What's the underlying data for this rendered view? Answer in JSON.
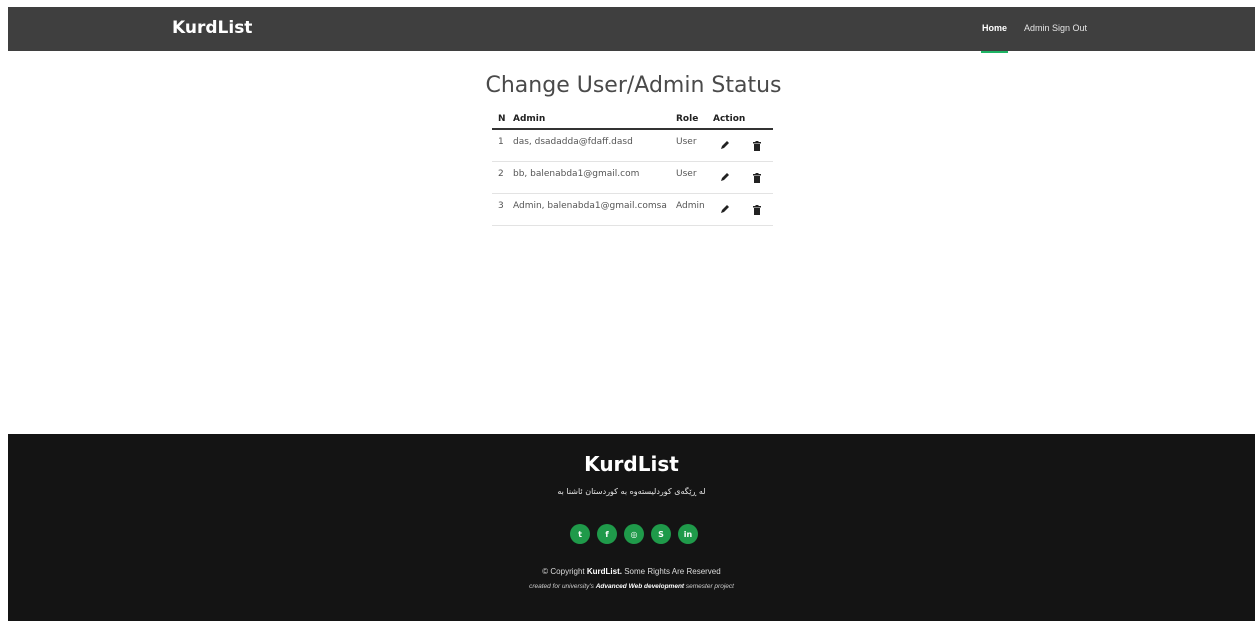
{
  "header": {
    "brand": "KurdList",
    "nav": [
      {
        "label": "Home"
      },
      {
        "label": "Admin Sign Out"
      }
    ]
  },
  "main": {
    "title": "Change User/Admin Status",
    "columns": [
      "N",
      "Admin",
      "Role",
      "Action"
    ],
    "rows": [
      {
        "n": "1",
        "admin": "das,  dsadadda@fdaff.dasd",
        "role": "User"
      },
      {
        "n": "2",
        "admin": "bb,  balenabda1@gmail.com",
        "role": "User"
      },
      {
        "n": "3",
        "admin": "Admin,  balenabda1@gmail.comsa",
        "role": "Admin"
      }
    ]
  },
  "footer": {
    "brand": "KurdList",
    "tagline": "له ڕێگەی کوردلیستەوە بە کوردستان ئاشنا بە",
    "socials": [
      {
        "icon": "twitter-icon",
        "glyph": "t"
      },
      {
        "icon": "facebook-icon",
        "glyph": "f"
      },
      {
        "icon": "instagram-icon",
        "glyph": "◎"
      },
      {
        "icon": "skype-icon",
        "glyph": "S"
      },
      {
        "icon": "linkedin-icon",
        "glyph": "in"
      }
    ],
    "copyright_prefix": "© Copyright",
    "copyright_brand": "KurdList.",
    "copyright_suffix": "Some Rights Are Reserved",
    "created_prefix": "created for university's",
    "created_bold": "Advanced Web development",
    "created_suffix": "semester project"
  },
  "colors": {
    "header_bg": "#3f3f3f",
    "accent": "#1eb464",
    "footer_bg": "#141414",
    "social_bg": "#1f9a4a"
  }
}
